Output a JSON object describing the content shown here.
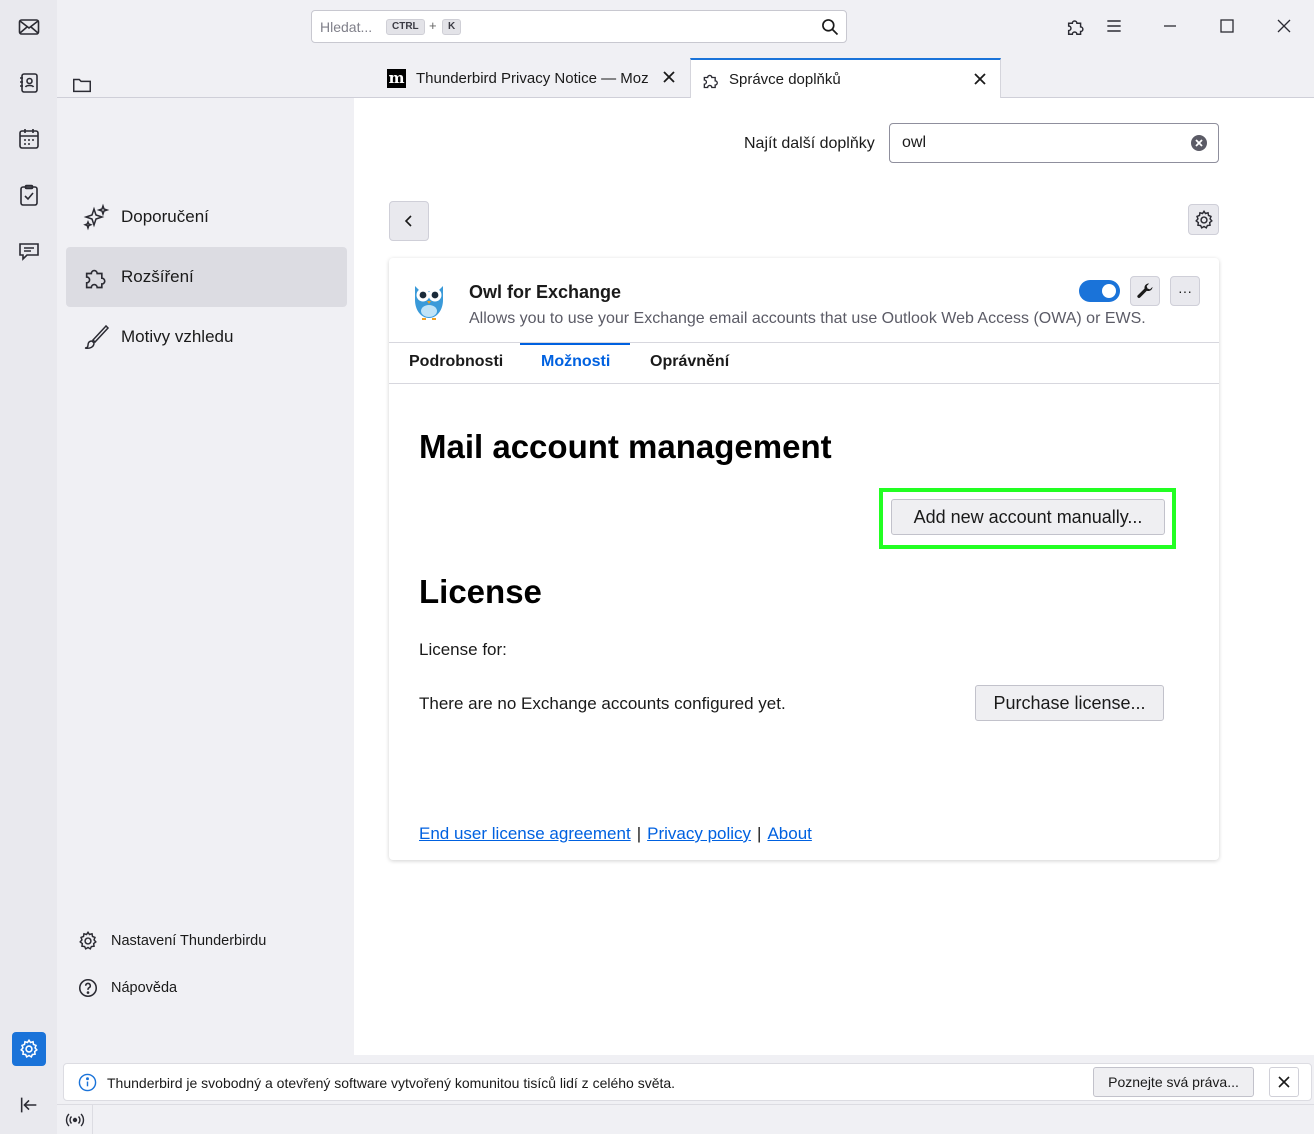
{
  "spaces": {
    "items": [
      "mail-icon",
      "address-book-icon",
      "calendar-icon",
      "tasks-icon",
      "chat-icon"
    ],
    "settings": "settings-icon",
    "collapse": "collapse-icon"
  },
  "titlebar": {
    "search_placeholder": "Hledat...",
    "shortcut_ctrl": "CTRL",
    "shortcut_plus": "+",
    "shortcut_key": "K"
  },
  "tabs": [
    {
      "title": "Thunderbird Privacy Notice — Mozi",
      "favicon": "m"
    },
    {
      "title": "Správce doplňků"
    }
  ],
  "sidebar": {
    "categories": [
      {
        "label": "Doporučení"
      },
      {
        "label": "Rozšíření"
      },
      {
        "label": "Motivy vzhledu"
      }
    ],
    "footer": {
      "settings_label": "Nastavení Thunderbirdu",
      "help_label": "Nápověda"
    }
  },
  "main": {
    "find_label": "Najít další doplňky",
    "find_value": "owl",
    "addon": {
      "name": "Owl for Exchange",
      "description": "Allows you to use your Exchange email accounts that use Outlook Web Access (OWA) or EWS.",
      "enabled": true,
      "more_label": "···"
    },
    "detail_tabs": [
      "Podrobnosti",
      "Možnosti",
      "Oprávnění"
    ],
    "active_tab": "Možnosti",
    "options": {
      "heading_mail": "Mail account management",
      "add_account_button": "Add new account manually...",
      "heading_license": "License",
      "license_for": "License for:",
      "no_accounts": "There are no Exchange accounts configured yet.",
      "purchase_button": "Purchase license...",
      "links": [
        "End user license agreement",
        "Privacy policy",
        "About"
      ],
      "link_sep": "|"
    }
  },
  "notification": {
    "text": "Thunderbird je svobodný a otevřený software vytvořený komunitou tisíců lidí z celého světa.",
    "button": "Poznejte svá práva..."
  },
  "colors": {
    "accent": "#1a73d9",
    "link": "#0061e0",
    "highlight": "#22ff22"
  }
}
